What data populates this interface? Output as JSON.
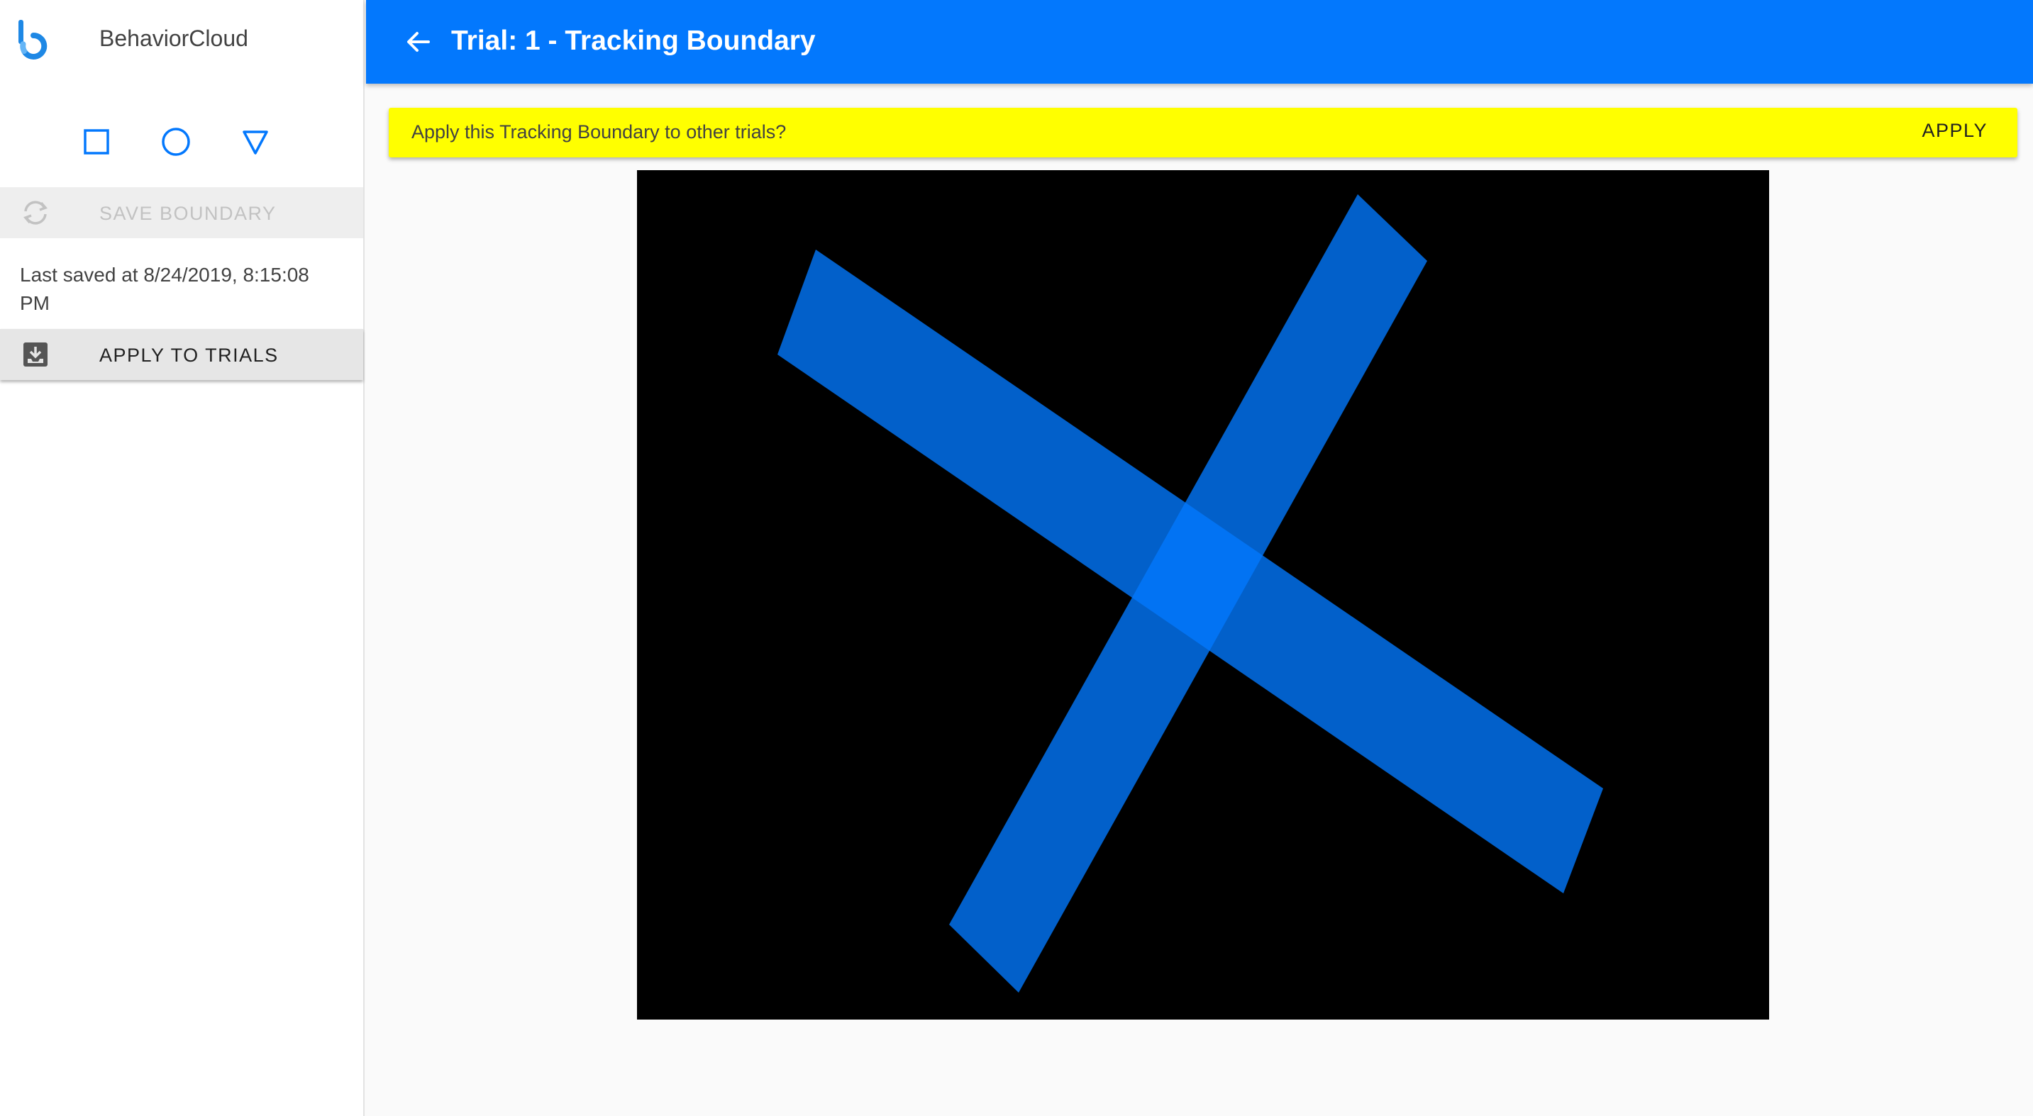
{
  "app": {
    "name": "BehaviorCloud"
  },
  "sidebar": {
    "tools": [
      {
        "name": "rectangle-tool",
        "icon": "square-icon"
      },
      {
        "name": "ellipse-tool",
        "icon": "circle-icon"
      },
      {
        "name": "polygon-tool",
        "icon": "triangle-icon"
      }
    ],
    "save_label": "SAVE BOUNDARY",
    "save_icon": "sync-icon",
    "save_disabled": true,
    "last_saved": "Last saved at 8/24/2019, 8:15:08 PM",
    "apply_label": "APPLY TO TRIALS",
    "apply_icon": "inbox-download-icon"
  },
  "header": {
    "title": "Trial: 1 - Tracking Boundary",
    "back_icon": "arrow-left-icon"
  },
  "banner": {
    "message": "Apply this Tracking Boundary to other trials?",
    "action_label": "APPLY",
    "color": "#ffff00"
  },
  "canvas": {
    "background": "#000000",
    "boundary_color": "#0378fd",
    "boundary_shape": "cross"
  },
  "colors": {
    "primary": "#0378fd",
    "banner": "#ffff00",
    "disabled_text": "#c2c2c2"
  }
}
